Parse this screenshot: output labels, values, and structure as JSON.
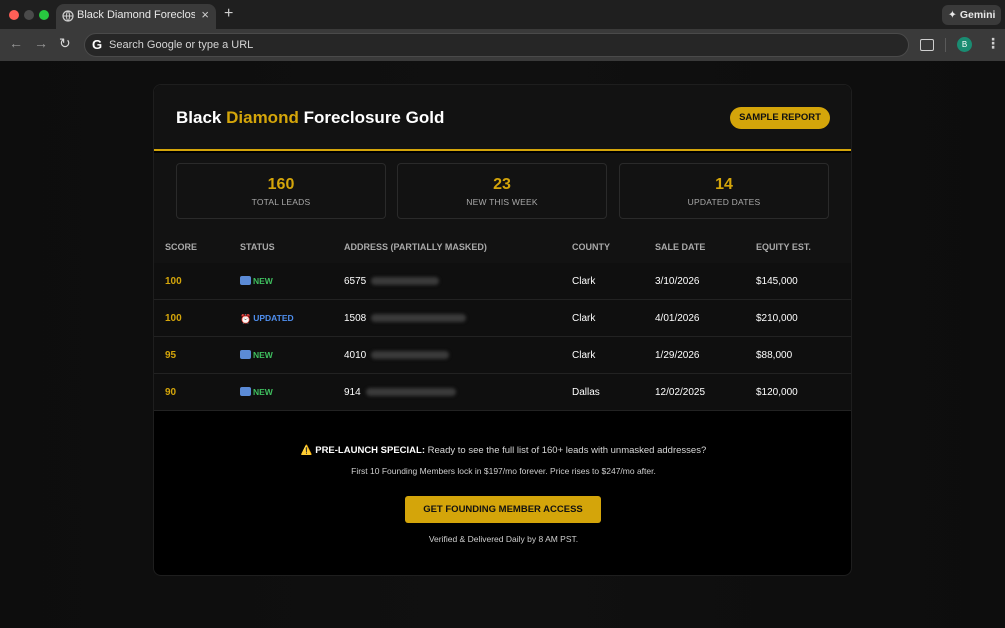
{
  "browser": {
    "tab_title": "Black Diamond Foreclosure G",
    "tab_close": "×",
    "new_tab": "+",
    "gemini_label": "Gemini",
    "gemini_icon": "✦",
    "omnibox_placeholder": "Search Google or type a URL",
    "google_glyph": "G",
    "avatar_initial": "B",
    "back_glyph": "←",
    "forward_glyph": "→",
    "reload_glyph": "↻",
    "menu_glyph": "⋮"
  },
  "header": {
    "brand_part1": "Black",
    "brand_accent": "Diamond",
    "brand_part2": "Foreclosure Gold",
    "sample_report_button": "SAMPLE REPORT"
  },
  "stats": [
    {
      "value": "160",
      "label": "TOTAL LEADS"
    },
    {
      "value": "23",
      "label": "NEW THIS WEEK"
    },
    {
      "value": "14",
      "label": "UPDATED DATES"
    }
  ],
  "table": {
    "columns": [
      "SCORE",
      "STATUS",
      "ADDRESS (PARTIALLY MASKED)",
      "COUNTY",
      "SALE DATE",
      "EQUITY EST."
    ],
    "rows": [
      {
        "score": "100",
        "status": "NEW",
        "status_icon": "new-icon",
        "address_number": "6575",
        "county": "Clark",
        "sale_date": "3/10/2026",
        "equity": "$145,000"
      },
      {
        "score": "100",
        "status": "UPDATED",
        "status_icon": "alarm-clock-icon",
        "address_number": "1508",
        "county": "Clark",
        "sale_date": "4/01/2026",
        "equity": "$210,000"
      },
      {
        "score": "95",
        "status": "NEW",
        "status_icon": "new-icon",
        "address_number": "4010",
        "county": "Clark",
        "sale_date": "1/29/2026",
        "equity": "$88,000"
      },
      {
        "score": "90",
        "status": "NEW",
        "status_icon": "new-icon",
        "address_number": "914",
        "county": "Dallas",
        "sale_date": "12/02/2025",
        "equity": "$120,000"
      }
    ]
  },
  "promo": {
    "warning_glyph": "⚠️",
    "headline_strong": "PRE-LAUNCH SPECIAL:",
    "headline_rest": "Ready to see the full list of 160+ leads with unmasked addresses?",
    "subline": "First 10 Founding Members lock in $197/mo forever. Price rises to $247/mo after.",
    "cta_button": "GET FOUNDING MEMBER ACCESS",
    "footer": "Verified & Delivered Daily by 8 AM PST."
  },
  "colors": {
    "accent_gold": "#d4a50a",
    "status_new": "#3fbf5f",
    "status_updated": "#4f8fef",
    "background": "#000000"
  }
}
